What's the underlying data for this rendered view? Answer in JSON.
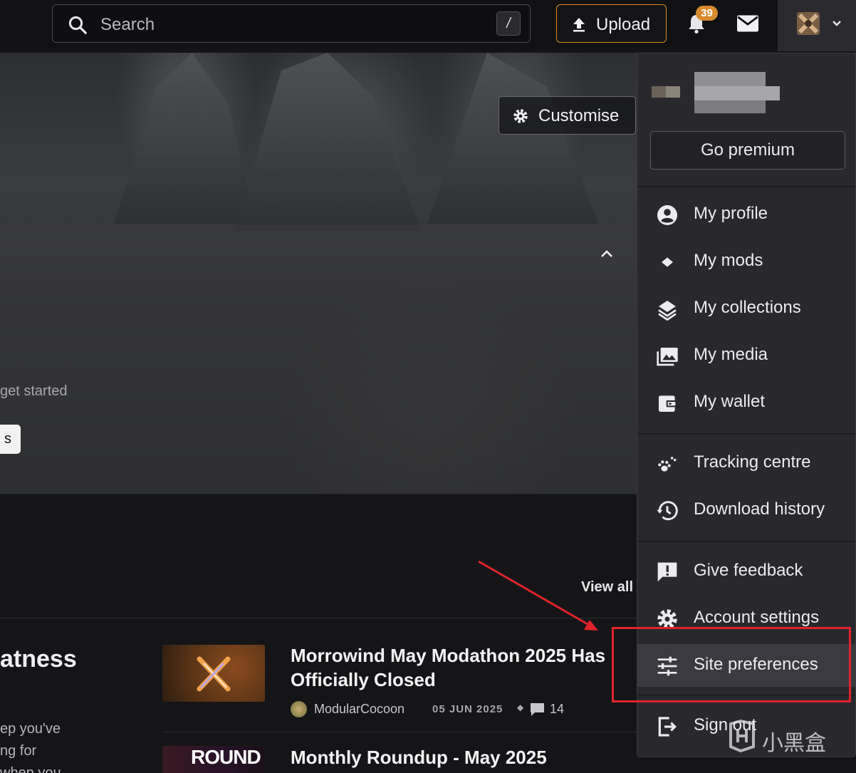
{
  "topbar": {
    "search_placeholder": "Search",
    "search_shortcut": "/",
    "upload_label": "Upload",
    "notification_count": "39"
  },
  "hero": {
    "customise_label": "Customise",
    "get_started_text": "get started",
    "button_text": "s"
  },
  "section": {
    "view_all": "View all",
    "heading_fragment": "atness",
    "text_lines": [
      "ep you've",
      "ng for",
      "when you"
    ]
  },
  "news": [
    {
      "title": "Morrowind May Modathon 2025 Has Officially Closed",
      "author": "ModularCocoon",
      "date": "05 JUN 2025",
      "comments": "14"
    },
    {
      "title": "Monthly Roundup - May 2025",
      "thumb_text": "ROUND UP"
    }
  ],
  "menu": {
    "go_premium": "Go premium",
    "items_group1": [
      {
        "label": "My profile",
        "icon": "user-circle-icon"
      },
      {
        "label": "My mods",
        "icon": "diamond-icon"
      },
      {
        "label": "My collections",
        "icon": "layers-icon"
      },
      {
        "label": "My media",
        "icon": "images-icon"
      },
      {
        "label": "My wallet",
        "icon": "wallet-icon"
      }
    ],
    "items_group2": [
      {
        "label": "Tracking centre",
        "icon": "paw-icon"
      },
      {
        "label": "Download history",
        "icon": "history-icon"
      }
    ],
    "items_group3": [
      {
        "label": "Give feedback",
        "icon": "feedback-icon"
      },
      {
        "label": "Account settings",
        "icon": "gear-icon"
      },
      {
        "label": "Site preferences",
        "icon": "sliders-icon"
      }
    ],
    "sign_out": "Sign out"
  },
  "watermark": "小黑盒",
  "colors": {
    "accent": "#d88a2c",
    "highlight_box": "#e0232a",
    "menu_bg": "#29292d"
  }
}
